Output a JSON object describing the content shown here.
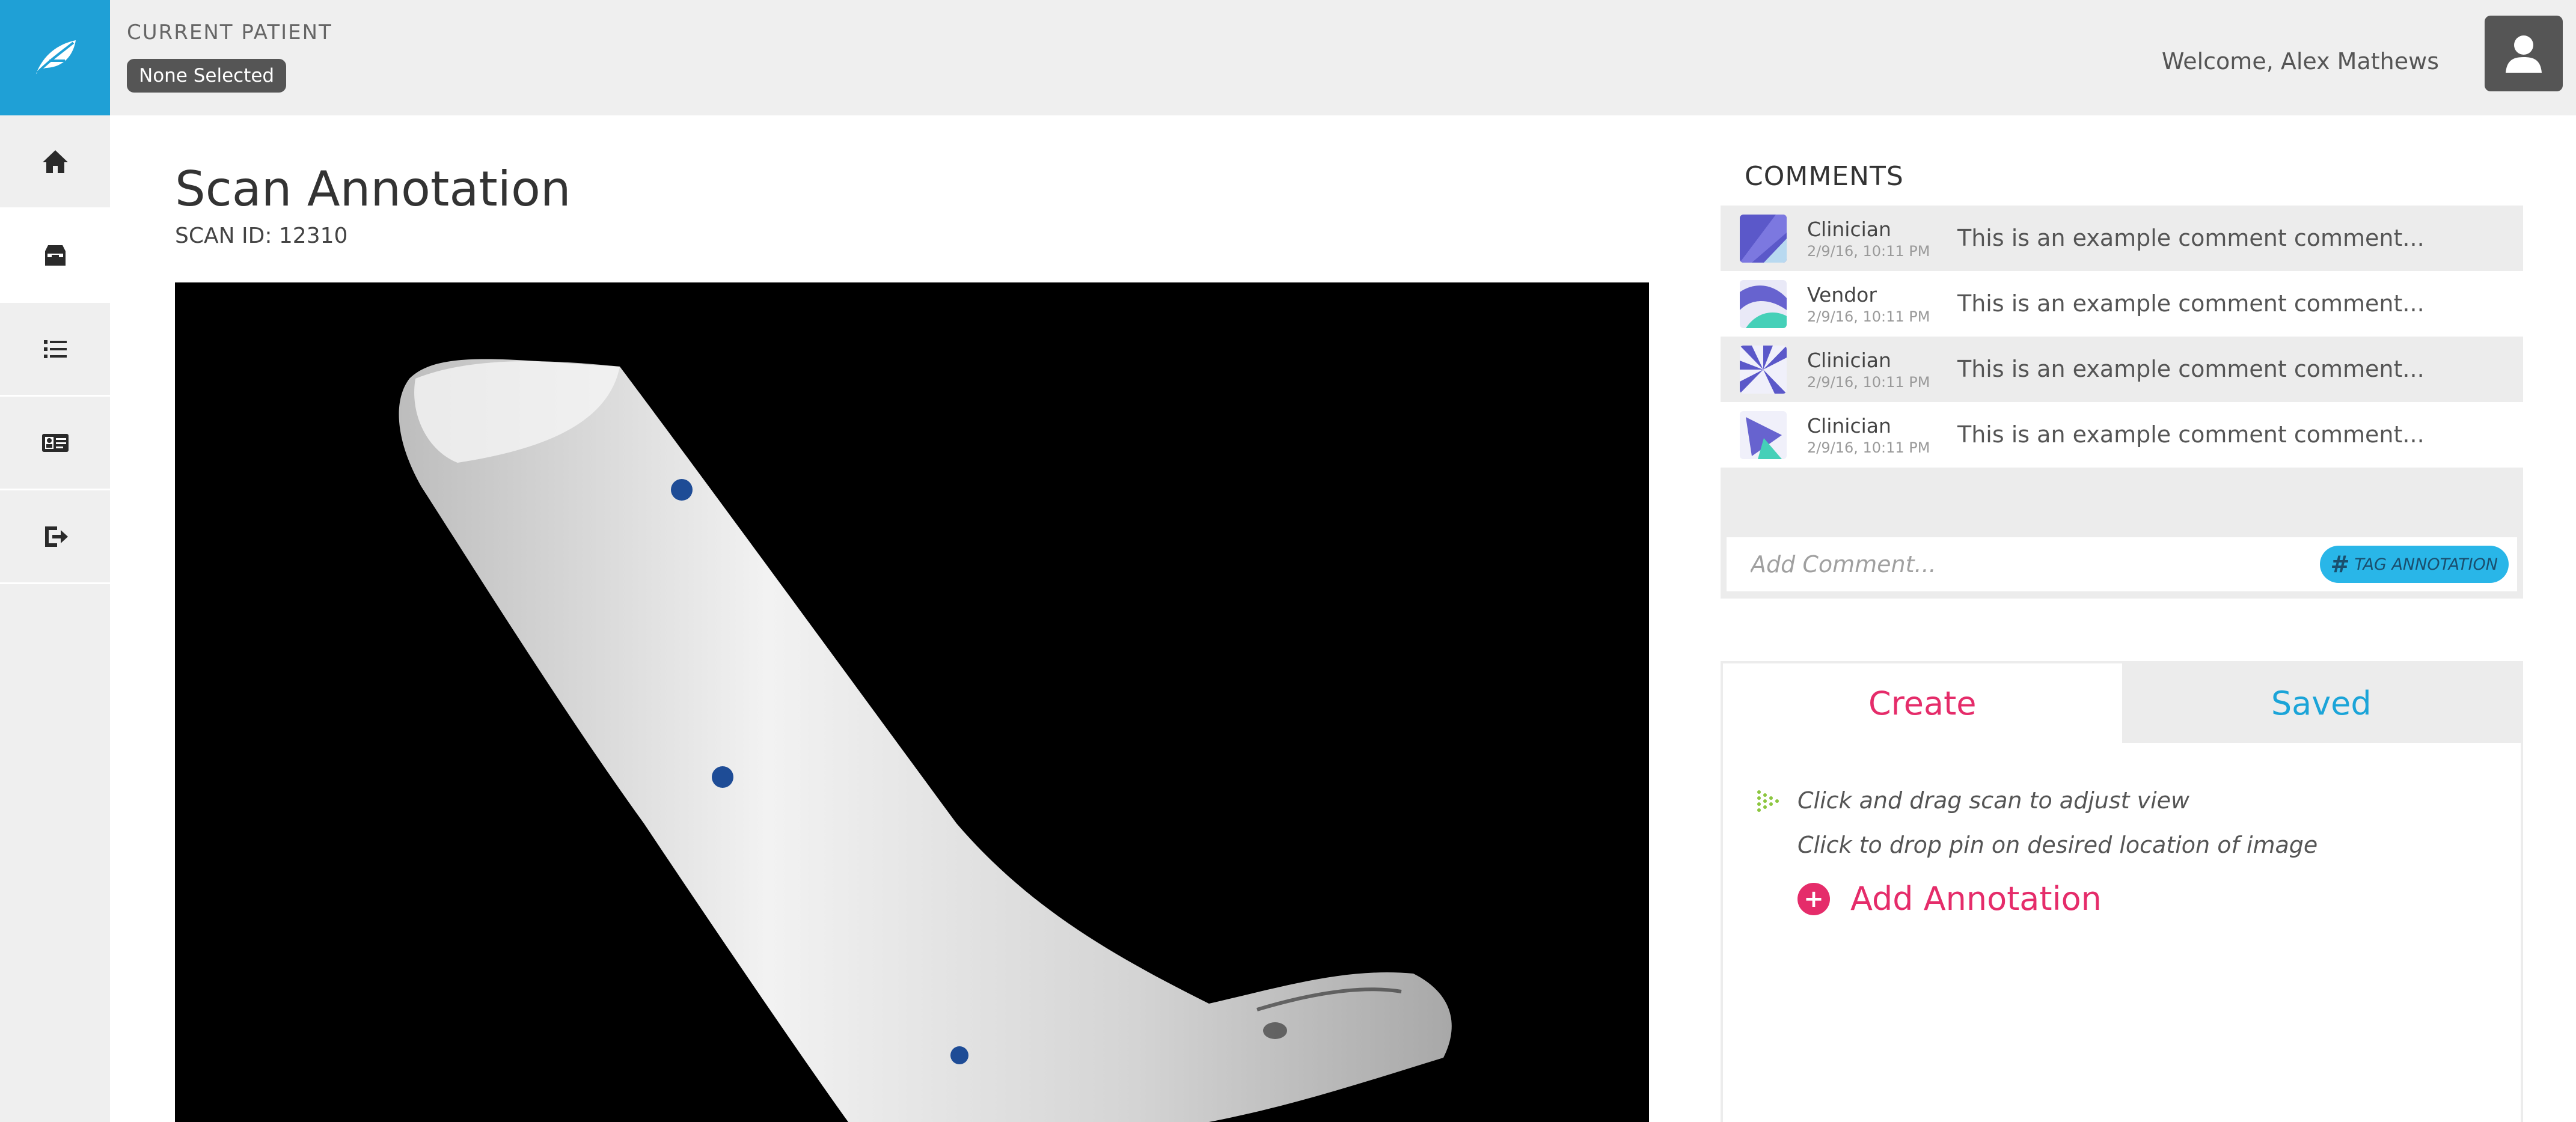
{
  "app": {
    "logo_icon": "leaf-icon",
    "accent": "#1fa0d6",
    "pink": "#e52c6a"
  },
  "sidebar": {
    "items": [
      {
        "name": "home",
        "icon": "home-icon"
      },
      {
        "name": "inbox",
        "icon": "inbox-icon"
      },
      {
        "name": "list",
        "icon": "list-icon"
      },
      {
        "name": "id-card",
        "icon": "id-card-icon"
      },
      {
        "name": "logout",
        "icon": "logout-icon"
      }
    ]
  },
  "header": {
    "current_patient_label": "CURRENT PATIENT",
    "patient_value": "None Selected",
    "welcome": "Welcome, Alex Mathews"
  },
  "main": {
    "title": "Scan Annotation",
    "scan_id": "SCAN ID: 12310"
  },
  "comments": {
    "title": "COMMENTS",
    "items": [
      {
        "role": "Clinician",
        "time": "2/9/16, 10:11 PM",
        "text": "This is an example comment comment..."
      },
      {
        "role": "Vendor",
        "time": "2/9/16, 10:11 PM",
        "text": "This is an example comment comment..."
      },
      {
        "role": "Clinician",
        "time": "2/9/16, 10:11 PM",
        "text": "This is an example comment comment..."
      },
      {
        "role": "Clinician",
        "time": "2/9/16, 10:11 PM",
        "text": "This is an example comment comment..."
      }
    ],
    "add_placeholder": "Add Comment...",
    "tag_label": "TAG ANNOTATION"
  },
  "annotate": {
    "tabs": [
      "Create",
      "Saved"
    ],
    "hint_drag": "Click and drag scan to adjust view",
    "hint_pin": "Click to drop pin on desired location of image",
    "add_label": "Add Annotation"
  }
}
